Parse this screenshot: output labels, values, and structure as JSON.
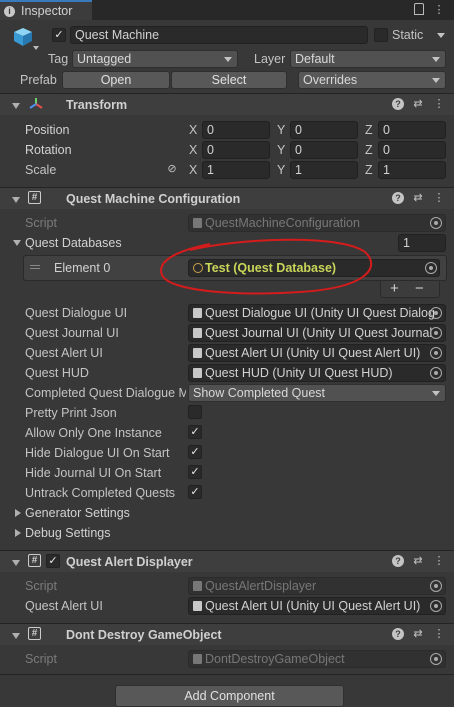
{
  "tab": {
    "title": "Inspector"
  },
  "object": {
    "name": "Quest Machine",
    "static_label": "Static",
    "tag_label": "Tag",
    "tag_value": "Untagged",
    "layer_label": "Layer",
    "layer_value": "Default",
    "prefab_label": "Prefab",
    "open_label": "Open",
    "select_label": "Select",
    "overrides_label": "Overrides"
  },
  "transform": {
    "title": "Transform",
    "position": {
      "label": "Position",
      "x": "0",
      "y": "0",
      "z": "0"
    },
    "rotation": {
      "label": "Rotation",
      "x": "0",
      "y": "0",
      "z": "0"
    },
    "scale": {
      "label": "Scale",
      "x": "1",
      "y": "1",
      "z": "1"
    },
    "axes": {
      "x": "X",
      "y": "Y",
      "z": "Z"
    }
  },
  "qmc": {
    "title": "Quest Machine Configuration",
    "script_label": "Script",
    "script_value": "QuestMachineConfiguration",
    "databases_label": "Quest Databases",
    "databases_count": "1",
    "element_label": "Element 0",
    "element_value": "Test (Quest Database)",
    "plus": "+",
    "minus": "−",
    "fields": [
      {
        "label": "Quest Dialogue UI",
        "value": "Quest Dialogue UI (Unity UI Quest Dialog"
      },
      {
        "label": "Quest Journal UI",
        "value": "Quest Journal UI (Unity UI Quest Journal"
      },
      {
        "label": "Quest Alert UI",
        "value": "Quest Alert UI (Unity UI Quest Alert UI)"
      },
      {
        "label": "Quest HUD",
        "value": "Quest HUD (Unity UI Quest HUD)"
      }
    ],
    "completed_label": "Completed Quest Dialogue M",
    "completed_value": "Show Completed Quest",
    "toggles": [
      {
        "label": "Pretty Print Json",
        "checked": false
      },
      {
        "label": "Allow Only One Instance",
        "checked": true
      },
      {
        "label": "Hide Dialogue UI On Start",
        "checked": true
      },
      {
        "label": "Hide Journal UI On Start",
        "checked": true
      },
      {
        "label": "Untrack Completed Quests",
        "checked": true
      }
    ],
    "generator_label": "Generator Settings",
    "debug_label": "Debug Settings"
  },
  "qad": {
    "title": "Quest Alert Displayer",
    "script_label": "Script",
    "script_value": "QuestAlertDisplayer",
    "alert_label": "Quest Alert UI",
    "alert_value": "Quest Alert UI (Unity UI Quest Alert UI)"
  },
  "ddg": {
    "title": "Dont Destroy GameObject",
    "script_label": "Script",
    "script_value": "DontDestroyGameObject"
  },
  "add_component": "Add Component",
  "glyphs": {
    "check": "✓",
    "help": "?",
    "settings": "⇄",
    "more": "⋮",
    "link": "⊘",
    "script": "#",
    "info": "i"
  },
  "colors": {
    "accent": "#3a79bb",
    "annotation": "#d41c1c",
    "highlight": "#c9d65a"
  }
}
